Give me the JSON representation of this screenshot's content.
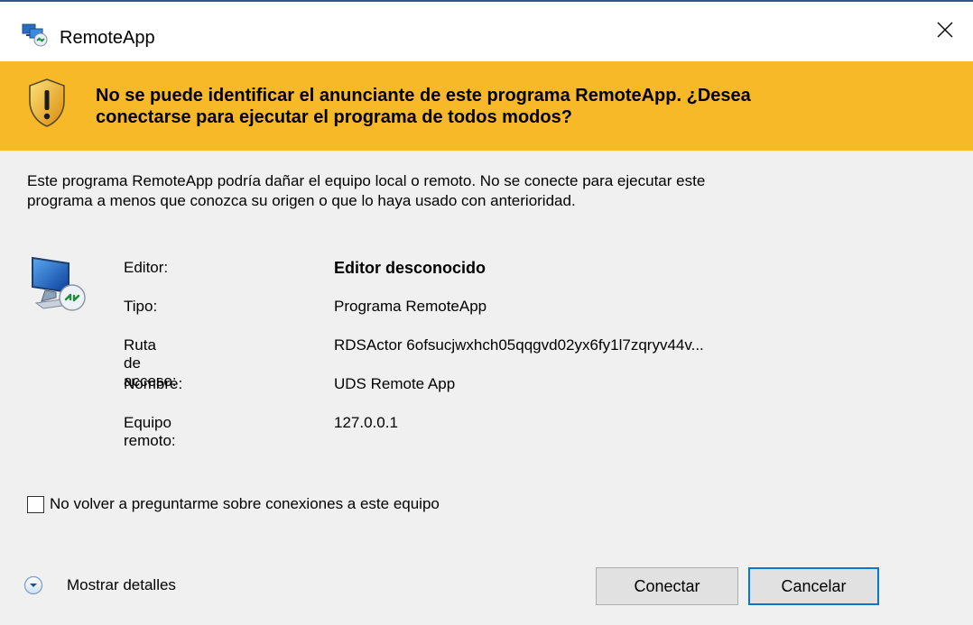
{
  "window": {
    "title": "RemoteApp",
    "icon": "remoteapp-icon",
    "close_icon": "close-icon"
  },
  "banner": {
    "icon": "warning-shield-icon",
    "line1": "No se puede identificar el anunciante de este programa RemoteApp. ¿Desea",
    "line2": "conectarse para ejecutar el programa de todos modos?",
    "background_color": "#f7b928"
  },
  "description": {
    "line1": "Este programa RemoteApp podría dañar el equipo local o remoto. No se conecte para ejecutar este",
    "line2": "programa a menos que conozca su origen o que lo haya usado con anterioridad."
  },
  "properties": {
    "icon": "remote-computer-icon",
    "rows": [
      {
        "label": "Editor:",
        "value": "Editor desconocido"
      },
      {
        "label": "Tipo:",
        "value": "Programa RemoteApp"
      },
      {
        "label": "Ruta de acceso:",
        "value": "RDSActor 6ofsucjwxhch05qqgvd02yx6fy1l7zqryv44v..."
      },
      {
        "label": "Nombre:",
        "value": "UDS Remote App"
      },
      {
        "label": "Equipo remoto:",
        "value": "127.0.0.1"
      }
    ]
  },
  "checkbox": {
    "label": "No volver a preguntarme sobre conexiones a este equipo",
    "checked": false
  },
  "footer": {
    "details_icon": "chevron-down-circle-icon",
    "details_label": "Mostrar detalles",
    "connect_label": "Conectar",
    "cancel_label": "Cancelar",
    "accent_color": "#0078d7"
  }
}
